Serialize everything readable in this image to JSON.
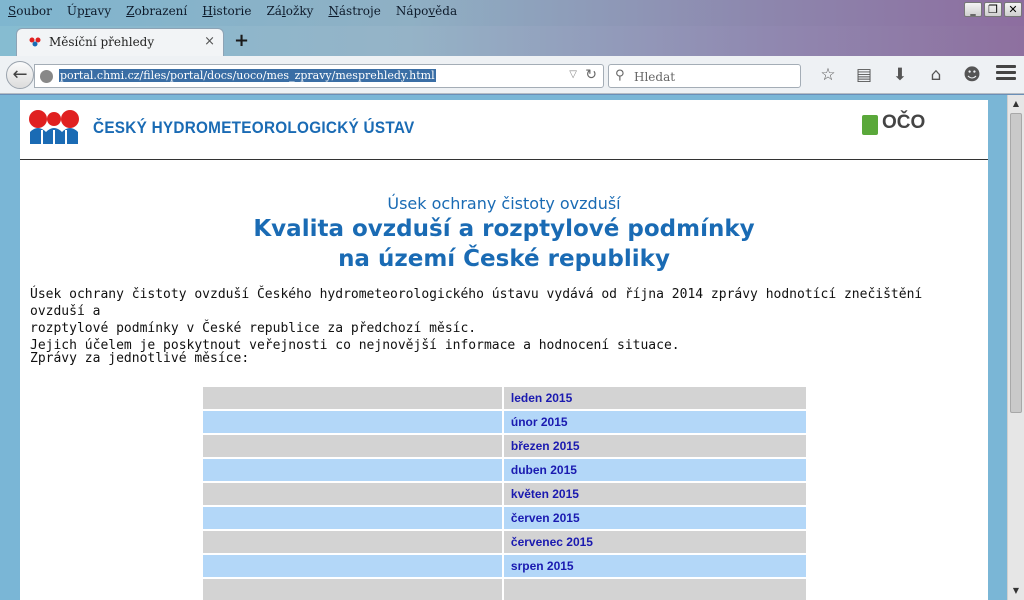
{
  "menu": [
    {
      "pre": "",
      "acc": "S",
      "post": "oubor"
    },
    {
      "pre": "Úp",
      "acc": "r",
      "post": "avy"
    },
    {
      "pre": "",
      "acc": "Z",
      "post": "obrazení"
    },
    {
      "pre": "",
      "acc": "H",
      "post": "istorie"
    },
    {
      "pre": "Zá",
      "acc": "l",
      "post": "ožky"
    },
    {
      "pre": "",
      "acc": "N",
      "post": "ástroje"
    },
    {
      "pre": "Nápo",
      "acc": "v",
      "post": "ěda"
    }
  ],
  "tab": {
    "title": "Měsíční přehledy",
    "close": "×"
  },
  "newtab": "+",
  "url": "portal.chmi.cz/files/portal/docs/uoco/mes_zpravy/mesprehledy.html",
  "search": {
    "placeholder": "Hledat"
  },
  "window_buttons": [
    "_",
    "❐",
    "✕"
  ],
  "site": {
    "name": "ČESKÝ HYDROMETEOROLOGICKÝ ÚSTAV",
    "oco": "OČO"
  },
  "subtitle": "Úsek ochrany čistoty ovzduší",
  "title_line1": "Kvalita ovzduší a rozptylové podmínky",
  "title_line2": "na území České republiky",
  "intro_line1": "Úsek ochrany čistoty ovzduší Českého hydrometeorologického ústavu vydává od října 2014 zprávy hodnotící znečištění ovzduší a",
  "intro_line2": "rozptylové podmínky v České republice za předchozí měsíc.",
  "intro_line3": "Jejich účelem je poskytnout veřejnosti co nejnovější informace a hodnocení situace.",
  "reports_label": "Zprávy za jednotlivé měsíce:",
  "months": [
    "leden 2015",
    "únor 2015",
    "březen 2015",
    "duben 2015",
    "květen 2015",
    "červen 2015",
    "červenec 2015",
    "srpen 2015",
    ""
  ]
}
